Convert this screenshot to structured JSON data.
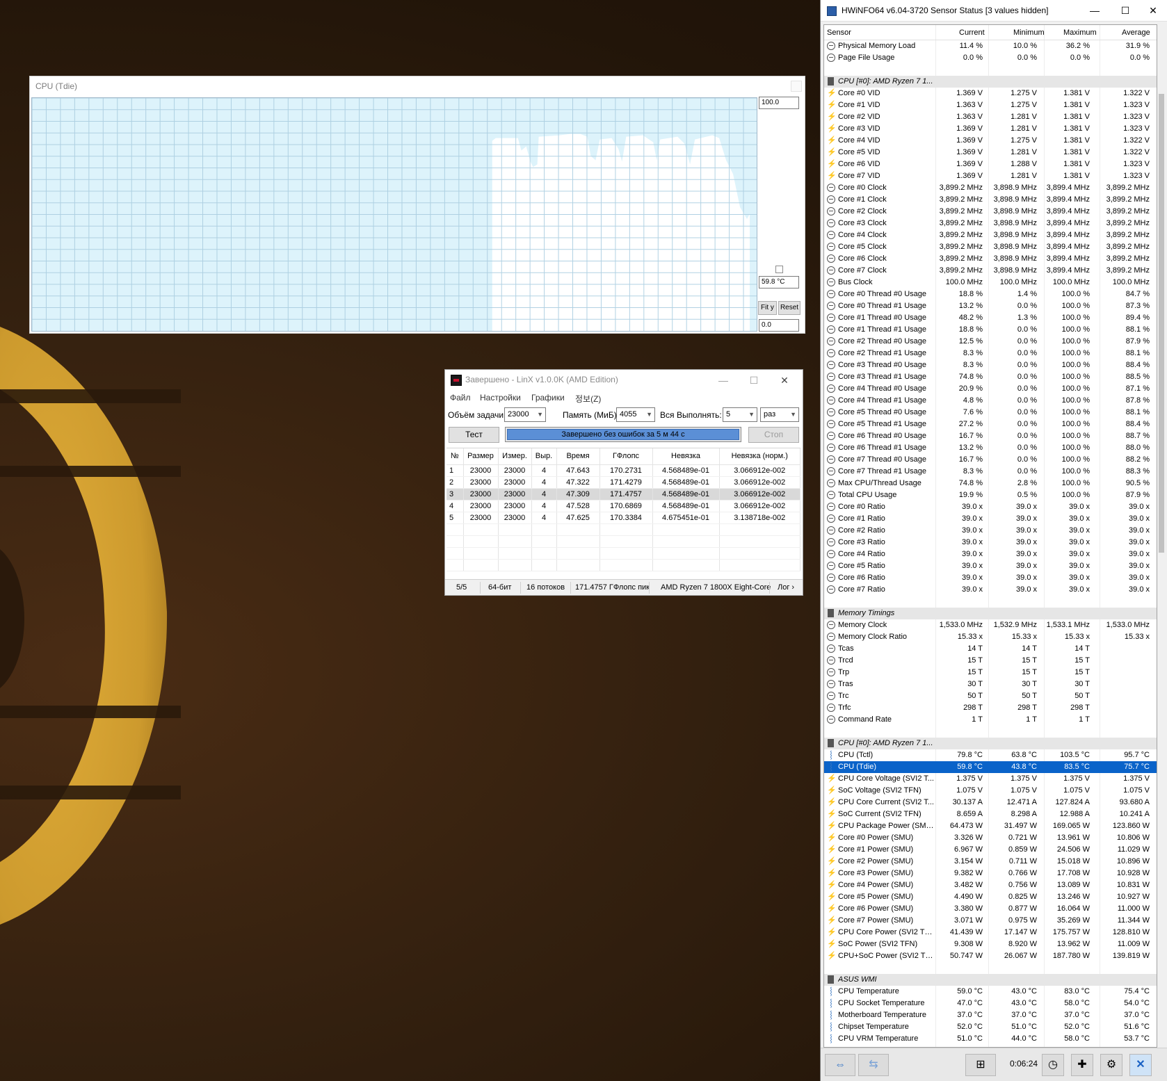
{
  "graph": {
    "title": "CPU (Tdie)",
    "max_value": "100.0",
    "current_value": "59.8 °C",
    "min_value": "0.0",
    "fit_label": "Fit y",
    "reset_label": "Reset"
  },
  "linx": {
    "title": "Завершено - LinX v1.0.0K (AMD Edition)",
    "menu": [
      "Файл",
      "Настройки",
      "Графики",
      "정보(Z)"
    ],
    "problem_size_label": "Объём задачи:",
    "problem_size_value": "23000",
    "memory_label": "Память (МиБ):",
    "memory_value": "4055",
    "all_label": "Вся",
    "runs_label": "Выполнять:",
    "runs_value": "5",
    "runs_unit": "раз",
    "test_label": "Тест",
    "stop_label": "Стоп",
    "progress_text": "Завершено без ошибок за 5 м 44 с",
    "progress": 1.0,
    "columns": [
      "№",
      "Размер",
      "Измер.",
      "Выр.",
      "Время",
      "ГФлопс",
      "Невязка",
      "Невязка (норм.)"
    ],
    "rows": [
      [
        "1",
        "23000",
        "23000",
        "4",
        "47.643",
        "170.2731",
        "4.568489e-01",
        "3.066912e-002"
      ],
      [
        "2",
        "23000",
        "23000",
        "4",
        "47.322",
        "171.4279",
        "4.568489e-01",
        "3.066912e-002"
      ],
      [
        "3",
        "23000",
        "23000",
        "4",
        "47.309",
        "171.4757",
        "4.568489e-01",
        "3.066912e-002"
      ],
      [
        "4",
        "23000",
        "23000",
        "4",
        "47.528",
        "170.6869",
        "4.568489e-01",
        "3.066912e-002"
      ],
      [
        "5",
        "23000",
        "23000",
        "4",
        "47.625",
        "170.3384",
        "4.675451e-01",
        "3.138718e-002"
      ]
    ],
    "status": [
      "5/5",
      "64-бит",
      "16 потоков",
      "171.4757 ГФлопс пик",
      "AMD Ryzen 7 1800X Eight-Core",
      "Лог ›"
    ]
  },
  "hwinfo": {
    "title": "HWiNFO64 v6.04-3720 Sensor Status [3 values hidden]",
    "columns": [
      "Sensor",
      "Current",
      "Minimum",
      "Maximum",
      "Average"
    ],
    "timer": "0:06:24",
    "rows": [
      {
        "t": "clock",
        "n": "Physical Memory Load",
        "v": [
          "11.4 %",
          "10.0 %",
          "36.2 %",
          "31.9 %"
        ]
      },
      {
        "t": "clock",
        "n": "Page File Usage",
        "v": [
          "0.0 %",
          "0.0 %",
          "0.0 %",
          "0.0 %"
        ]
      },
      {
        "t": "blank"
      },
      {
        "t": "group",
        "n": "CPU [#0]: AMD Ryzen 7 1..."
      },
      {
        "t": "bolt",
        "n": "Core #0 VID",
        "v": [
          "1.369 V",
          "1.275 V",
          "1.381 V",
          "1.322 V"
        ]
      },
      {
        "t": "bolt",
        "n": "Core #1 VID",
        "v": [
          "1.363 V",
          "1.275 V",
          "1.381 V",
          "1.323 V"
        ]
      },
      {
        "t": "bolt",
        "n": "Core #2 VID",
        "v": [
          "1.363 V",
          "1.281 V",
          "1.381 V",
          "1.323 V"
        ]
      },
      {
        "t": "bolt",
        "n": "Core #3 VID",
        "v": [
          "1.369 V",
          "1.281 V",
          "1.381 V",
          "1.323 V"
        ]
      },
      {
        "t": "bolt",
        "n": "Core #4 VID",
        "v": [
          "1.369 V",
          "1.275 V",
          "1.381 V",
          "1.322 V"
        ]
      },
      {
        "t": "bolt",
        "n": "Core #5 VID",
        "v": [
          "1.369 V",
          "1.281 V",
          "1.381 V",
          "1.322 V"
        ]
      },
      {
        "t": "bolt",
        "n": "Core #6 VID",
        "v": [
          "1.369 V",
          "1.288 V",
          "1.381 V",
          "1.323 V"
        ]
      },
      {
        "t": "bolt",
        "n": "Core #7 VID",
        "v": [
          "1.369 V",
          "1.281 V",
          "1.381 V",
          "1.323 V"
        ]
      },
      {
        "t": "clock",
        "n": "Core #0 Clock",
        "v": [
          "3,899.2 MHz",
          "3,898.9 MHz",
          "3,899.4 MHz",
          "3,899.2 MHz"
        ]
      },
      {
        "t": "clock",
        "n": "Core #1 Clock",
        "v": [
          "3,899.2 MHz",
          "3,898.9 MHz",
          "3,899.4 MHz",
          "3,899.2 MHz"
        ]
      },
      {
        "t": "clock",
        "n": "Core #2 Clock",
        "v": [
          "3,899.2 MHz",
          "3,898.9 MHz",
          "3,899.4 MHz",
          "3,899.2 MHz"
        ]
      },
      {
        "t": "clock",
        "n": "Core #3 Clock",
        "v": [
          "3,899.2 MHz",
          "3,898.9 MHz",
          "3,899.4 MHz",
          "3,899.2 MHz"
        ]
      },
      {
        "t": "clock",
        "n": "Core #4 Clock",
        "v": [
          "3,899.2 MHz",
          "3,898.9 MHz",
          "3,899.4 MHz",
          "3,899.2 MHz"
        ]
      },
      {
        "t": "clock",
        "n": "Core #5 Clock",
        "v": [
          "3,899.2 MHz",
          "3,898.9 MHz",
          "3,899.4 MHz",
          "3,899.2 MHz"
        ]
      },
      {
        "t": "clock",
        "n": "Core #6 Clock",
        "v": [
          "3,899.2 MHz",
          "3,898.9 MHz",
          "3,899.4 MHz",
          "3,899.2 MHz"
        ]
      },
      {
        "t": "clock",
        "n": "Core #7 Clock",
        "v": [
          "3,899.2 MHz",
          "3,898.9 MHz",
          "3,899.4 MHz",
          "3,899.2 MHz"
        ]
      },
      {
        "t": "clock",
        "n": "Bus Clock",
        "v": [
          "100.0 MHz",
          "100.0 MHz",
          "100.0 MHz",
          "100.0 MHz"
        ]
      },
      {
        "t": "clock",
        "n": "Core #0 Thread #0 Usage",
        "v": [
          "18.8 %",
          "1.4 %",
          "100.0 %",
          "84.7 %"
        ]
      },
      {
        "t": "clock",
        "n": "Core #0 Thread #1 Usage",
        "v": [
          "13.2 %",
          "0.0 %",
          "100.0 %",
          "87.3 %"
        ]
      },
      {
        "t": "clock",
        "n": "Core #1 Thread #0 Usage",
        "v": [
          "48.2 %",
          "1.3 %",
          "100.0 %",
          "89.4 %"
        ]
      },
      {
        "t": "clock",
        "n": "Core #1 Thread #1 Usage",
        "v": [
          "18.8 %",
          "0.0 %",
          "100.0 %",
          "88.1 %"
        ]
      },
      {
        "t": "clock",
        "n": "Core #2 Thread #0 Usage",
        "v": [
          "12.5 %",
          "0.0 %",
          "100.0 %",
          "87.9 %"
        ]
      },
      {
        "t": "clock",
        "n": "Core #2 Thread #1 Usage",
        "v": [
          "8.3 %",
          "0.0 %",
          "100.0 %",
          "88.1 %"
        ]
      },
      {
        "t": "clock",
        "n": "Core #3 Thread #0 Usage",
        "v": [
          "8.3 %",
          "0.0 %",
          "100.0 %",
          "88.4 %"
        ]
      },
      {
        "t": "clock",
        "n": "Core #3 Thread #1 Usage",
        "v": [
          "74.8 %",
          "0.0 %",
          "100.0 %",
          "88.5 %"
        ]
      },
      {
        "t": "clock",
        "n": "Core #4 Thread #0 Usage",
        "v": [
          "20.9 %",
          "0.0 %",
          "100.0 %",
          "87.1 %"
        ]
      },
      {
        "t": "clock",
        "n": "Core #4 Thread #1 Usage",
        "v": [
          "4.8 %",
          "0.0 %",
          "100.0 %",
          "87.8 %"
        ]
      },
      {
        "t": "clock",
        "n": "Core #5 Thread #0 Usage",
        "v": [
          "7.6 %",
          "0.0 %",
          "100.0 %",
          "88.1 %"
        ]
      },
      {
        "t": "clock",
        "n": "Core #5 Thread #1 Usage",
        "v": [
          "27.2 %",
          "0.0 %",
          "100.0 %",
          "88.4 %"
        ]
      },
      {
        "t": "clock",
        "n": "Core #6 Thread #0 Usage",
        "v": [
          "16.7 %",
          "0.0 %",
          "100.0 %",
          "88.7 %"
        ]
      },
      {
        "t": "clock",
        "n": "Core #6 Thread #1 Usage",
        "v": [
          "13.2 %",
          "0.0 %",
          "100.0 %",
          "88.0 %"
        ]
      },
      {
        "t": "clock",
        "n": "Core #7 Thread #0 Usage",
        "v": [
          "16.7 %",
          "0.0 %",
          "100.0 %",
          "88.2 %"
        ]
      },
      {
        "t": "clock",
        "n": "Core #7 Thread #1 Usage",
        "v": [
          "8.3 %",
          "0.0 %",
          "100.0 %",
          "88.3 %"
        ]
      },
      {
        "t": "clock",
        "n": "Max CPU/Thread Usage",
        "v": [
          "74.8 %",
          "2.8 %",
          "100.0 %",
          "90.5 %"
        ]
      },
      {
        "t": "clock",
        "n": "Total CPU Usage",
        "v": [
          "19.9 %",
          "0.5 %",
          "100.0 %",
          "87.9 %"
        ]
      },
      {
        "t": "clock",
        "n": "Core #0 Ratio",
        "v": [
          "39.0 x",
          "39.0 x",
          "39.0 x",
          "39.0 x"
        ]
      },
      {
        "t": "clock",
        "n": "Core #1 Ratio",
        "v": [
          "39.0 x",
          "39.0 x",
          "39.0 x",
          "39.0 x"
        ]
      },
      {
        "t": "clock",
        "n": "Core #2 Ratio",
        "v": [
          "39.0 x",
          "39.0 x",
          "39.0 x",
          "39.0 x"
        ]
      },
      {
        "t": "clock",
        "n": "Core #3 Ratio",
        "v": [
          "39.0 x",
          "39.0 x",
          "39.0 x",
          "39.0 x"
        ]
      },
      {
        "t": "clock",
        "n": "Core #4 Ratio",
        "v": [
          "39.0 x",
          "39.0 x",
          "39.0 x",
          "39.0 x"
        ]
      },
      {
        "t": "clock",
        "n": "Core #5 Ratio",
        "v": [
          "39.0 x",
          "39.0 x",
          "39.0 x",
          "39.0 x"
        ]
      },
      {
        "t": "clock",
        "n": "Core #6 Ratio",
        "v": [
          "39.0 x",
          "39.0 x",
          "39.0 x",
          "39.0 x"
        ]
      },
      {
        "t": "clock",
        "n": "Core #7 Ratio",
        "v": [
          "39.0 x",
          "39.0 x",
          "39.0 x",
          "39.0 x"
        ]
      },
      {
        "t": "blank"
      },
      {
        "t": "group",
        "n": "Memory Timings"
      },
      {
        "t": "clock",
        "n": "Memory Clock",
        "v": [
          "1,533.0 MHz",
          "1,532.9 MHz",
          "1,533.1 MHz",
          "1,533.0 MHz"
        ]
      },
      {
        "t": "clock",
        "n": "Memory Clock Ratio",
        "v": [
          "15.33 x",
          "15.33 x",
          "15.33 x",
          "15.33 x"
        ]
      },
      {
        "t": "clock",
        "n": "Tcas",
        "v": [
          "14 T",
          "14 T",
          "14 T",
          ""
        ]
      },
      {
        "t": "clock",
        "n": "Trcd",
        "v": [
          "15 T",
          "15 T",
          "15 T",
          ""
        ]
      },
      {
        "t": "clock",
        "n": "Trp",
        "v": [
          "15 T",
          "15 T",
          "15 T",
          ""
        ]
      },
      {
        "t": "clock",
        "n": "Tras",
        "v": [
          "30 T",
          "30 T",
          "30 T",
          ""
        ]
      },
      {
        "t": "clock",
        "n": "Trc",
        "v": [
          "50 T",
          "50 T",
          "50 T",
          ""
        ]
      },
      {
        "t": "clock",
        "n": "Trfc",
        "v": [
          "298 T",
          "298 T",
          "298 T",
          ""
        ]
      },
      {
        "t": "clock",
        "n": "Command Rate",
        "v": [
          "1 T",
          "1 T",
          "1 T",
          ""
        ]
      },
      {
        "t": "blank"
      },
      {
        "t": "group",
        "n": "CPU [#0]: AMD Ryzen 7 1..."
      },
      {
        "t": "therm",
        "n": "CPU (Tctl)",
        "v": [
          "79.8 °C",
          "63.8 °C",
          "103.5 °C",
          "95.7 °C"
        ]
      },
      {
        "t": "therm",
        "n": "CPU (Tdie)",
        "v": [
          "59.8 °C",
          "43.8 °C",
          "83.5 °C",
          "75.7 °C"
        ],
        "sel": true
      },
      {
        "t": "bolt",
        "n": "CPU Core Voltage (SVI2 T...",
        "v": [
          "1.375 V",
          "1.375 V",
          "1.375 V",
          "1.375 V"
        ]
      },
      {
        "t": "bolt",
        "n": "SoC Voltage (SVI2 TFN)",
        "v": [
          "1.075 V",
          "1.075 V",
          "1.075 V",
          "1.075 V"
        ]
      },
      {
        "t": "bolt",
        "n": "CPU Core Current (SVI2 T...",
        "v": [
          "30.137 A",
          "12.471 A",
          "127.824 A",
          "93.680 A"
        ]
      },
      {
        "t": "bolt",
        "n": "SoC Current (SVI2 TFN)",
        "v": [
          "8.659 A",
          "8.298 A",
          "12.988 A",
          "10.241 A"
        ]
      },
      {
        "t": "bolt",
        "n": "CPU Package Power (SMU)",
        "v": [
          "64.473 W",
          "31.497 W",
          "169.065 W",
          "123.860 W"
        ]
      },
      {
        "t": "bolt",
        "n": "Core #0 Power (SMU)",
        "v": [
          "3.326 W",
          "0.721 W",
          "13.961 W",
          "10.806 W"
        ]
      },
      {
        "t": "bolt",
        "n": "Core #1 Power (SMU)",
        "v": [
          "6.967 W",
          "0.859 W",
          "24.506 W",
          "11.029 W"
        ]
      },
      {
        "t": "bolt",
        "n": "Core #2 Power (SMU)",
        "v": [
          "3.154 W",
          "0.711 W",
          "15.018 W",
          "10.896 W"
        ]
      },
      {
        "t": "bolt",
        "n": "Core #3 Power (SMU)",
        "v": [
          "9.382 W",
          "0.766 W",
          "17.708 W",
          "10.928 W"
        ]
      },
      {
        "t": "bolt",
        "n": "Core #4 Power (SMU)",
        "v": [
          "3.482 W",
          "0.756 W",
          "13.089 W",
          "10.831 W"
        ]
      },
      {
        "t": "bolt",
        "n": "Core #5 Power (SMU)",
        "v": [
          "4.490 W",
          "0.825 W",
          "13.246 W",
          "10.927 W"
        ]
      },
      {
        "t": "bolt",
        "n": "Core #6 Power (SMU)",
        "v": [
          "3.380 W",
          "0.877 W",
          "16.064 W",
          "11.000 W"
        ]
      },
      {
        "t": "bolt",
        "n": "Core #7 Power (SMU)",
        "v": [
          "3.071 W",
          "0.975 W",
          "35.269 W",
          "11.344 W"
        ]
      },
      {
        "t": "bolt",
        "n": "CPU Core Power (SVI2 TFN)",
        "v": [
          "41.439 W",
          "17.147 W",
          "175.757 W",
          "128.810 W"
        ]
      },
      {
        "t": "bolt",
        "n": "SoC Power (SVI2 TFN)",
        "v": [
          "9.308 W",
          "8.920 W",
          "13.962 W",
          "11.009 W"
        ]
      },
      {
        "t": "bolt",
        "n": "CPU+SoC Power (SVI2 TFN)",
        "v": [
          "50.747 W",
          "26.067 W",
          "187.780 W",
          "139.819 W"
        ]
      },
      {
        "t": "blank"
      },
      {
        "t": "group",
        "n": "ASUS WMI"
      },
      {
        "t": "therm",
        "n": "CPU Temperature",
        "v": [
          "59.0 °C",
          "43.0 °C",
          "83.0 °C",
          "75.4 °C"
        ]
      },
      {
        "t": "therm",
        "n": "CPU Socket Temperature",
        "v": [
          "47.0 °C",
          "43.0 °C",
          "58.0 °C",
          "54.0 °C"
        ]
      },
      {
        "t": "therm",
        "n": "Motherboard Temperature",
        "v": [
          "37.0 °C",
          "37.0 °C",
          "37.0 °C",
          "37.0 °C"
        ]
      },
      {
        "t": "therm",
        "n": "Chipset Temperature",
        "v": [
          "52.0 °C",
          "51.0 °C",
          "52.0 °C",
          "51.6 °C"
        ]
      },
      {
        "t": "therm",
        "n": "CPU VRM Temperature",
        "v": [
          "51.0 °C",
          "44.0 °C",
          "58.0 °C",
          "53.7 °C"
        ]
      }
    ]
  }
}
